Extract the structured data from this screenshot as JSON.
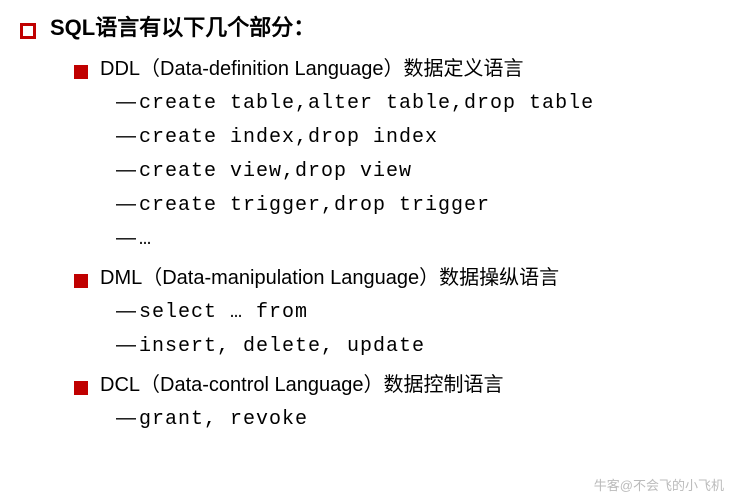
{
  "title": "SQL语言有以下几个部分：",
  "sections": [
    {
      "heading": "DDL（Data-definition Language）数据定义语言",
      "items": [
        "create table,alter table,drop table",
        "create index,drop index",
        "create view,drop view",
        "create trigger,drop trigger",
        "…"
      ]
    },
    {
      "heading": "DML（Data-manipulation Language）数据操纵语言",
      "items": [
        "select … from",
        "insert, delete, update"
      ]
    },
    {
      "heading": "DCL（Data-control Language）数据控制语言",
      "items": [
        "grant, revoke"
      ]
    }
  ],
  "watermark": "牛客@不会飞的小飞机",
  "dash": "—"
}
